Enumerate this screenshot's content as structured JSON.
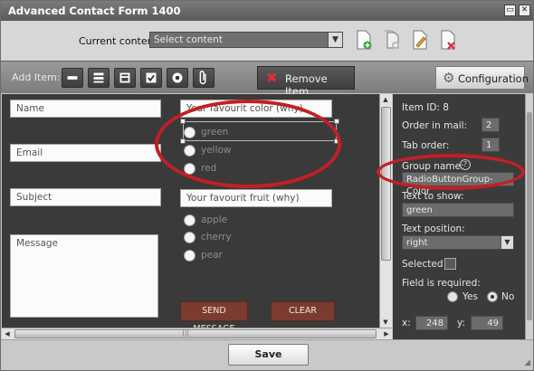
{
  "window": {
    "title": "Advanced Contact Form 1400",
    "minimize_glyph": "▭",
    "close_glyph": "✕"
  },
  "topbar": {
    "current_content_label": "Current content:",
    "select_value": "Select content",
    "icons": [
      "add-document-icon",
      "copy-document-icon",
      "edit-document-icon",
      "delete-document-icon"
    ]
  },
  "toolbar": {
    "add_item_label": "Add Item:",
    "item_buttons": [
      "single-line-field-icon",
      "multi-line-field-icon",
      "select-box-icon",
      "checkbox-icon",
      "radio-button-icon",
      "attachment-icon"
    ],
    "remove_label": "Remove Item",
    "config_label": "Configuration"
  },
  "form": {
    "name_placeholder": "Name",
    "email_placeholder": "Email",
    "subject_placeholder": "Subject",
    "message_placeholder": "Message",
    "color_question": "Your favourit color (why)",
    "colors": [
      "green",
      "yellow",
      "red"
    ],
    "fruit_question": "Your favourit fruit (why)",
    "fruits": [
      "apple",
      "cherry",
      "pear"
    ],
    "send_label": "SEND MESSAGE",
    "clear_label": "CLEAR"
  },
  "scrollbars": {
    "h_thumb_grip": "|||"
  },
  "properties": {
    "item_id_label": "Item ID: 8",
    "order_in_mail_label": "Order in mail:",
    "order_in_mail_value": "2",
    "tab_order_label": "Tab order:",
    "tab_order_value": "1",
    "group_name_label": "Group name:",
    "help_glyph": "?",
    "group_name_value": "RadioButtonGroup-Color",
    "text_to_show_label": "Text to show:",
    "text_to_show_value": "green",
    "text_position_label": "Text position:",
    "text_position_value": "right",
    "selected_label": "Selected",
    "required_label": "Field is required:",
    "yes_label": "Yes",
    "no_label": "No",
    "required_value": "No",
    "x_label": "x:",
    "x_value": "248",
    "y_label": "y:",
    "y_value": "49"
  },
  "footer": {
    "save_label": "Save"
  },
  "colors": {
    "highlight": "#c31f26",
    "button_red": "#7b3b2e",
    "panel_dark": "#3b3b3b"
  }
}
